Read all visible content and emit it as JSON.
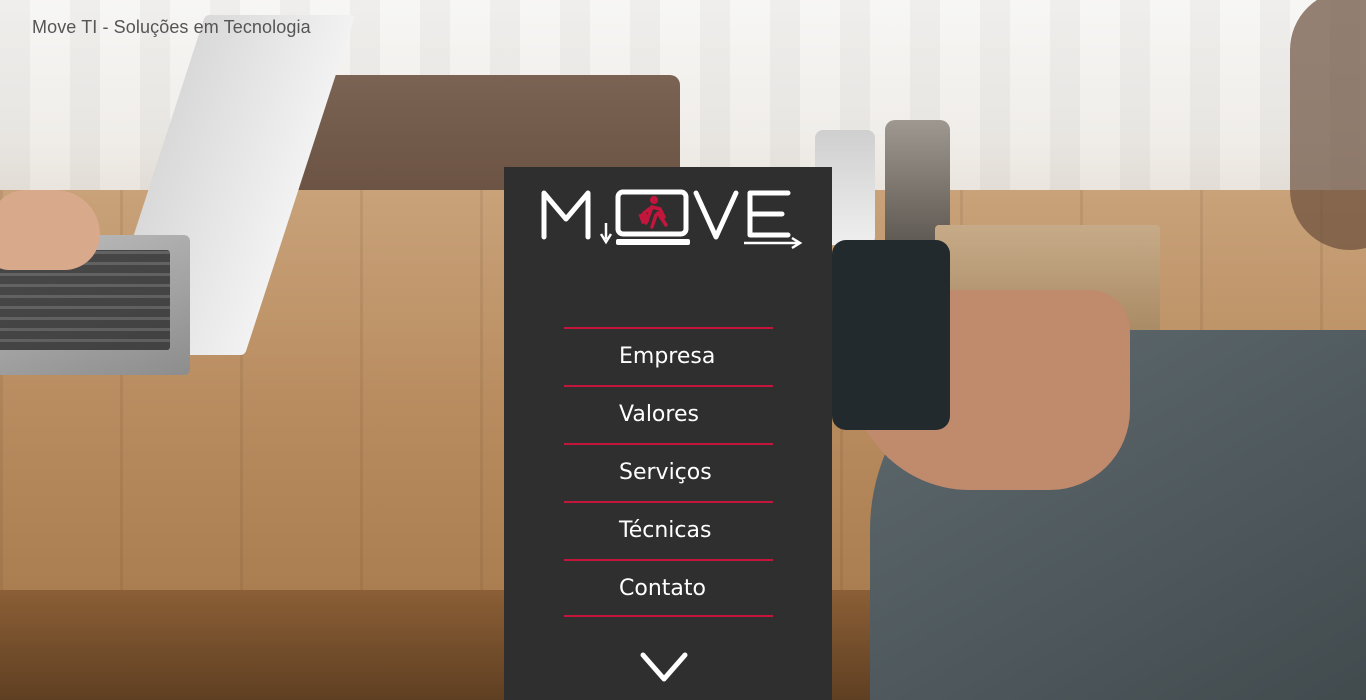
{
  "site": {
    "title": "Move TI - Soluções em Tecnologia"
  },
  "logo": {
    "text": "MOVE"
  },
  "nav": {
    "items": [
      {
        "label": "Empresa"
      },
      {
        "label": "Valores"
      },
      {
        "label": "Serviços"
      },
      {
        "label": "Técnicas"
      },
      {
        "label": "Contato"
      }
    ]
  },
  "scroll": {
    "icon": "chevron-down-icon"
  },
  "colors": {
    "panel": "#2f2f2f",
    "accent": "#c2163d",
    "text": "#ffffff"
  }
}
